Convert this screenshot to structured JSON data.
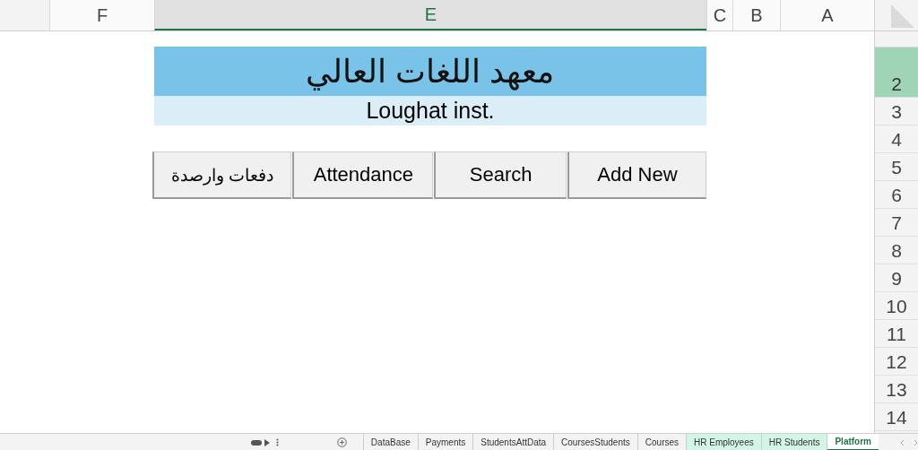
{
  "column_headers": [
    {
      "label": "F",
      "selected": false
    },
    {
      "label": "E",
      "selected": true
    },
    {
      "label": "C",
      "selected": false
    },
    {
      "label": "B",
      "selected": false
    },
    {
      "label": "A",
      "selected": false
    }
  ],
  "row_headers": [
    {
      "label": "2",
      "selected": true
    },
    {
      "label": "3",
      "selected": false
    },
    {
      "label": "4",
      "selected": false
    },
    {
      "label": "5",
      "selected": false
    },
    {
      "label": "6",
      "selected": false
    },
    {
      "label": "7",
      "selected": false
    },
    {
      "label": "8",
      "selected": false
    },
    {
      "label": "9",
      "selected": false
    },
    {
      "label": "10",
      "selected": false
    },
    {
      "label": "11",
      "selected": false
    },
    {
      "label": "12",
      "selected": false
    },
    {
      "label": "13",
      "selected": false
    },
    {
      "label": "14",
      "selected": false
    }
  ],
  "banner": {
    "title": "معهد اللغات العالي",
    "subtitle": "Loughat inst."
  },
  "buttons": [
    "دفعات وارصدة",
    "Attendance",
    "Search",
    "Add New"
  ],
  "sheet_tabs": [
    {
      "label": "DataBase",
      "selected": false
    },
    {
      "label": "Payments",
      "selected": false
    },
    {
      "label": "StudentsAttData",
      "selected": false
    },
    {
      "label": "CoursesStudents",
      "selected": false
    },
    {
      "label": "Courses",
      "selected": false
    },
    {
      "label": "HR Employees",
      "selected": false,
      "color": "#d3f5e6"
    },
    {
      "label": "HR Students",
      "selected": false,
      "color": "#d3f5e6"
    },
    {
      "label": "Platform",
      "selected": true
    }
  ]
}
